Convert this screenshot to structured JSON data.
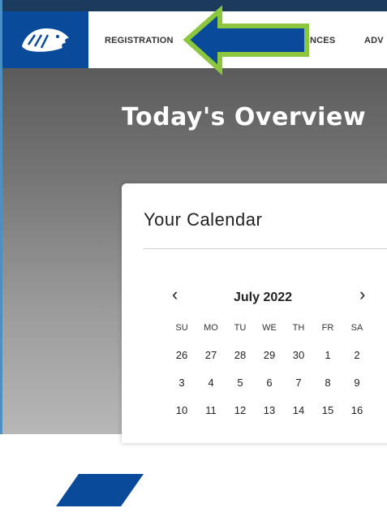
{
  "nav": {
    "items": [
      "REGISTRATION",
      "NCES",
      "ADV"
    ]
  },
  "hero": {
    "title": "Today's Overview"
  },
  "calendar": {
    "card_title": "Your Calendar",
    "month_label": "July 2022",
    "prev_arrow": "‹",
    "next_arrow": "›",
    "weekdays": [
      "SU",
      "MO",
      "TU",
      "WE",
      "TH",
      "FR",
      "SA"
    ],
    "weeks": [
      [
        "26",
        "27",
        "28",
        "29",
        "30",
        "1",
        "2"
      ],
      [
        "3",
        "4",
        "5",
        "6",
        "7",
        "8",
        "9"
      ],
      [
        "10",
        "11",
        "12",
        "13",
        "14",
        "15",
        "16"
      ]
    ]
  },
  "colors": {
    "brand_blue": "#0a4a9a",
    "highlight_arrow_fill": "#0a4a9a",
    "highlight_arrow_outline": "#8cc63f"
  },
  "icons": {
    "logo": "bearcat-mascot-logo",
    "annotation": "green-outlined-arrow-icon"
  }
}
